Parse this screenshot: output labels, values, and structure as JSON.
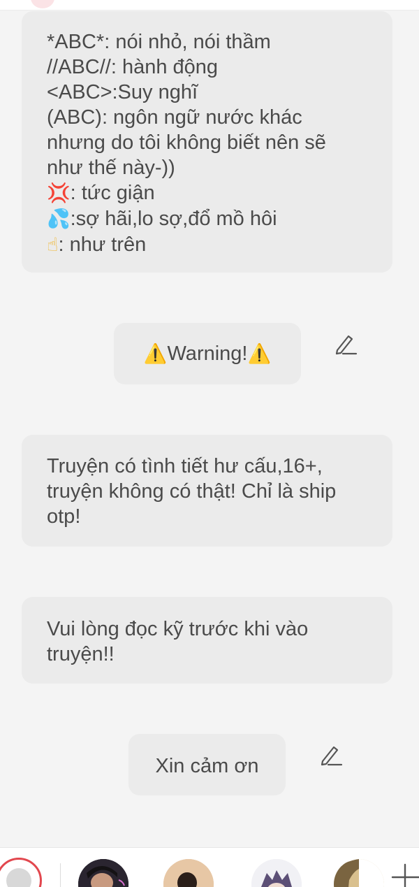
{
  "messages": [
    {
      "lines": [
        {
          "text": "*ABC*: nói nhỏ, nói thầm"
        },
        {
          "text": "//ABC//: hành động"
        },
        {
          "text": "<ABC>:Suy nghĩ"
        },
        {
          "text": "(ABC): ngôn ngữ nước khác"
        },
        {
          "text": "nhưng do tôi không biết nên sẽ"
        },
        {
          "text": "như thế này-))"
        },
        {
          "emoji": "💢",
          "text": ": tức giận"
        },
        {
          "emoji": "💦",
          "text": ":sợ hãi,lo sợ,đổ mồ hôi"
        },
        {
          "emoji": "☝",
          "text": ": như trên"
        }
      ]
    },
    {
      "emoji_left": "⚠️",
      "text": "Warning!",
      "emoji_right": "⚠️"
    },
    {
      "lines": [
        {
          "text": "Truyện có tình tiết hư cấu,16+,"
        },
        {
          "text": "truyện không có thật! Chỉ là ship"
        },
        {
          "text": "otp!"
        }
      ]
    },
    {
      "lines": [
        {
          "text": "Vui lòng đọc kỹ trước khi vào"
        },
        {
          "text": "truyện!!"
        }
      ]
    },
    {
      "text": "Xin cảm ơn"
    }
  ],
  "icons": {
    "edit": "pencil-icon",
    "add": "plus-icon",
    "chat": "chat-icon"
  },
  "colors": {
    "background": "#f4f4f4",
    "bubble": "#ebebeb",
    "text": "#4a4a4a",
    "accent": "#e2474e"
  }
}
